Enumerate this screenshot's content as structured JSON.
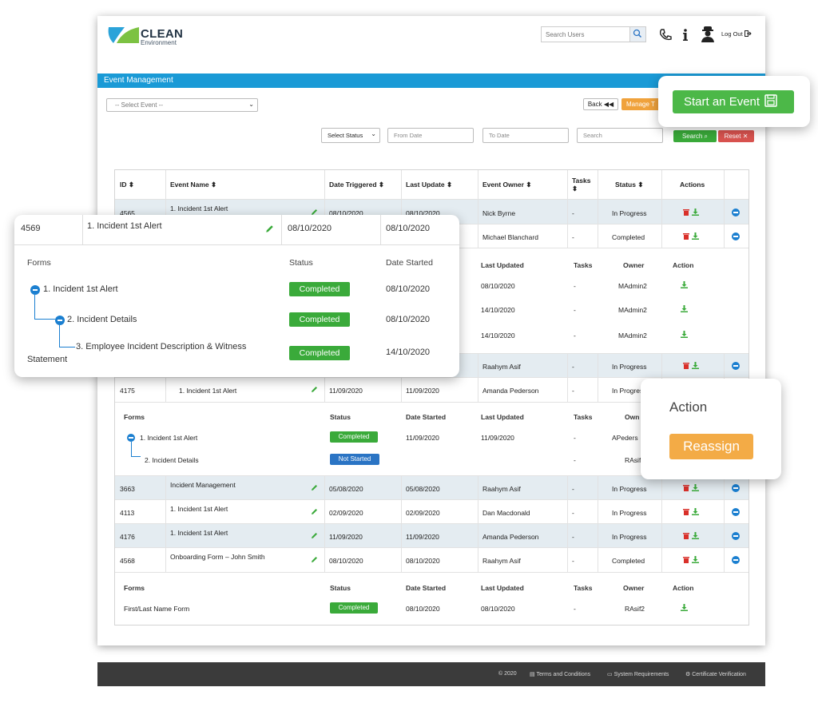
{
  "header": {
    "logo_name": "CLEAN",
    "logo_sub": "Environment",
    "search_placeholder": "Search Users",
    "logout_label": "Log Out"
  },
  "page_bar": {
    "title": "Event Management"
  },
  "toolbar": {
    "select_event": "-- Select Event --",
    "back_label": "Back",
    "manage_label": "Manage T",
    "start_event_label": "Start an Event"
  },
  "filters": {
    "status": "Select Status",
    "from_date": "From Date",
    "to_date": "To Date",
    "search_placeholder": "Search",
    "search_button": "Search",
    "reset_button": "Reset"
  },
  "table": {
    "headers": {
      "id": "ID",
      "event_name": "Event Name",
      "date_triggered": "Date Triggered",
      "last_update": "Last Update",
      "event_owner": "Event Owner",
      "tasks": "Tasks",
      "status": "Status",
      "actions": "Actions"
    },
    "rows": [
      {
        "id": "4565",
        "name": "1. Incident 1st Alert",
        "triggered": "08/10/2020",
        "updated": "08/10/2020",
        "owner": "Nick Byrne",
        "tasks": "-",
        "status": "In Progress"
      },
      {
        "owner": "Michael Blanchard",
        "tasks": "-",
        "status": "Completed"
      },
      {
        "owner": "Raahym Asif",
        "tasks": "-",
        "status": "In Progress"
      },
      {
        "id": "4175",
        "name": "1. Incident 1st Alert",
        "triggered": "11/09/2020",
        "updated": "11/09/2020",
        "owner": "Amanda Pederson",
        "tasks": "-",
        "status": "In Progress"
      },
      {
        "id": "3663",
        "name": "Incident Management",
        "triggered": "05/08/2020",
        "updated": "05/08/2020",
        "owner": "Raahym Asif",
        "tasks": "-",
        "status": "In Progress"
      },
      {
        "id": "4113",
        "name": "1. Incident 1st Alert",
        "triggered": "02/09/2020",
        "updated": "02/09/2020",
        "owner": "Dan Macdonald",
        "tasks": "-",
        "status": "In Progress"
      },
      {
        "id": "4176",
        "name": "1. Incident 1st Alert",
        "triggered": "11/09/2020",
        "updated": "11/09/2020",
        "owner": "Amanda Pederson",
        "tasks": "-",
        "status": "In Progress"
      },
      {
        "id": "4568",
        "name": "Onboarding Form – John Smith",
        "triggered": "08/10/2020",
        "updated": "08/10/2020",
        "owner": "Raahym Asif",
        "tasks": "-",
        "status": "Completed"
      }
    ],
    "sub1": {
      "headers": {
        "last_updated": "Last Updated",
        "tasks": "Tasks",
        "owner": "Owner",
        "action": "Action"
      },
      "rows": [
        {
          "updated": "08/10/2020",
          "tasks": "-",
          "owner": "MAdmin2"
        },
        {
          "updated": "14/10/2020",
          "tasks": "-",
          "owner": "MAdmin2"
        },
        {
          "updated": "14/10/2020",
          "tasks": "-",
          "owner": "MAdmin2"
        }
      ]
    },
    "sub2": {
      "headers": {
        "forms": "Forms",
        "status": "Status",
        "date_started": "Date Started",
        "last_updated": "Last Updated",
        "tasks": "Tasks",
        "owner": "Own"
      },
      "rows": [
        {
          "form": "1. Incident 1st Alert",
          "status": "Completed",
          "started": "11/09/2020",
          "updated": "11/09/2020",
          "tasks": "-",
          "owner": "APeders"
        },
        {
          "form": "2. Incident Details",
          "status": "Not Started",
          "tasks": "-",
          "owner": "RAsif"
        }
      ]
    },
    "sub3": {
      "headers": {
        "forms": "Forms",
        "status": "Status",
        "date_started": "Date Started",
        "last_updated": "Last Updated",
        "tasks": "Tasks",
        "owner": "Owner",
        "action": "Action"
      },
      "rows": [
        {
          "form": "First/Last Name Form",
          "status": "Completed",
          "started": "08/10/2020",
          "updated": "08/10/2020",
          "tasks": "-",
          "owner": "RAsif2"
        }
      ]
    }
  },
  "zoom_card": {
    "row": {
      "id": "4569",
      "name": "1. Incident 1st Alert",
      "triggered": "08/10/2020",
      "updated": "08/10/2020"
    },
    "headers": {
      "forms": "Forms",
      "status": "Status",
      "date_started": "Date Started"
    },
    "forms": [
      {
        "form": "1. Incident 1st Alert",
        "status": "Completed",
        "started": "08/10/2020"
      },
      {
        "form": "2. Incident Details",
        "status": "Completed",
        "started": "08/10/2020"
      },
      {
        "form": "3. Employee Incident Description & Witness",
        "form_cont": "Statement",
        "status": "Completed",
        "started": "14/10/2020"
      }
    ]
  },
  "action_card": {
    "title": "Action",
    "reassign_label": "Reassign"
  },
  "footer": {
    "copyright": "© 2020",
    "terms": "Terms and Conditions",
    "requirements": "System Requirements",
    "certificate": "Certificate Verification"
  },
  "colors": {
    "brand_blue": "#1a9ad6",
    "success": "#3aaa3a",
    "danger": "#d9534f",
    "warning": "#f0a23c",
    "info": "#2a74c4"
  },
  "icons": [
    "search-icon",
    "phone-icon",
    "info-icon",
    "user-icon",
    "logout-icon",
    "back-icon",
    "calendar-save-icon",
    "reset-x-icon",
    "sort-icon",
    "pencil-icon",
    "trash-icon",
    "download-icon",
    "expand-icon"
  ]
}
